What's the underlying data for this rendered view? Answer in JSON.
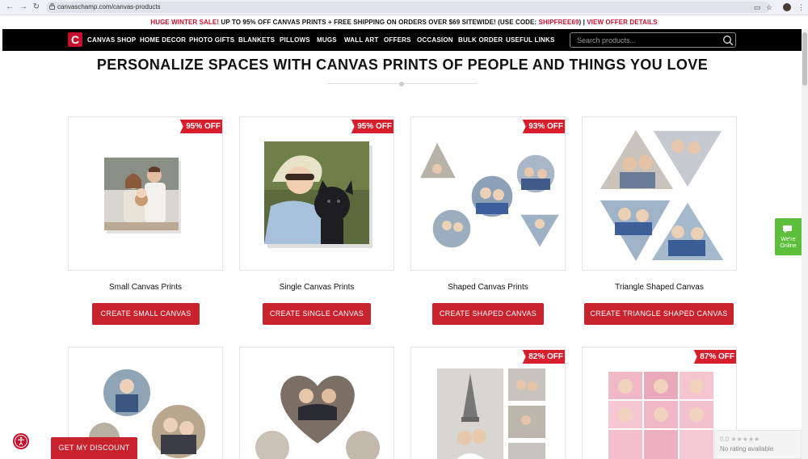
{
  "browser": {
    "url": "canvaschamp.com/canvas-products"
  },
  "promo": {
    "part1": "HUGE WINTER SALE!",
    "part2": " UP TO 95% OFF CANVAS PRINTS + FREE SHIPPING ON ORDERS OVER $69 SITEWIDE! (USE CODE: ",
    "code": "SHIPFREE69",
    "part3": ") | ",
    "link": "VIEW OFFER DETAILS"
  },
  "nav": {
    "logo_letter": "C",
    "items": [
      "CANVAS SHOP",
      "HOME DECOR",
      "PHOTO GIFTS",
      "BLANKETS",
      "PILLOWS",
      "MUGS",
      "WALL ART",
      "OFFERS",
      "OCCASION",
      "BULK ORDER",
      "USEFUL LINKS"
    ],
    "search_placeholder": "Search products..."
  },
  "heading": "PERSONALIZE SPACES WITH CANVAS PRINTS OF PEOPLE AND THINGS YOU LOVE",
  "products": [
    {
      "name": "Small Canvas Prints",
      "badge": "95% OFF",
      "cta": "CREATE SMALL CANVAS"
    },
    {
      "name": "Single Canvas Prints",
      "badge": "95% OFF",
      "cta": "CREATE SINGLE CANVAS"
    },
    {
      "name": "Shaped Canvas Prints",
      "badge": "93% OFF",
      "cta": "CREATE SHAPED CANVAS"
    },
    {
      "name": "Triangle Shaped Canvas",
      "badge": "",
      "cta": "CREATE TRIANGLE SHAPED CANVAS"
    },
    {
      "badge": ""
    },
    {
      "badge": ""
    },
    {
      "badge": "82% OFF"
    },
    {
      "badge": "87% OFF"
    }
  ],
  "widgets": {
    "online_line1": "We're",
    "online_line2": "Online",
    "discount": "GET MY DISCOUNT",
    "rating_score": "0.0 ★★★★★",
    "rating_text": "No rating available"
  },
  "colors": {
    "brand_red": "#c8222d",
    "nav_bg": "#000000",
    "chat_green": "#5cbe3a"
  }
}
